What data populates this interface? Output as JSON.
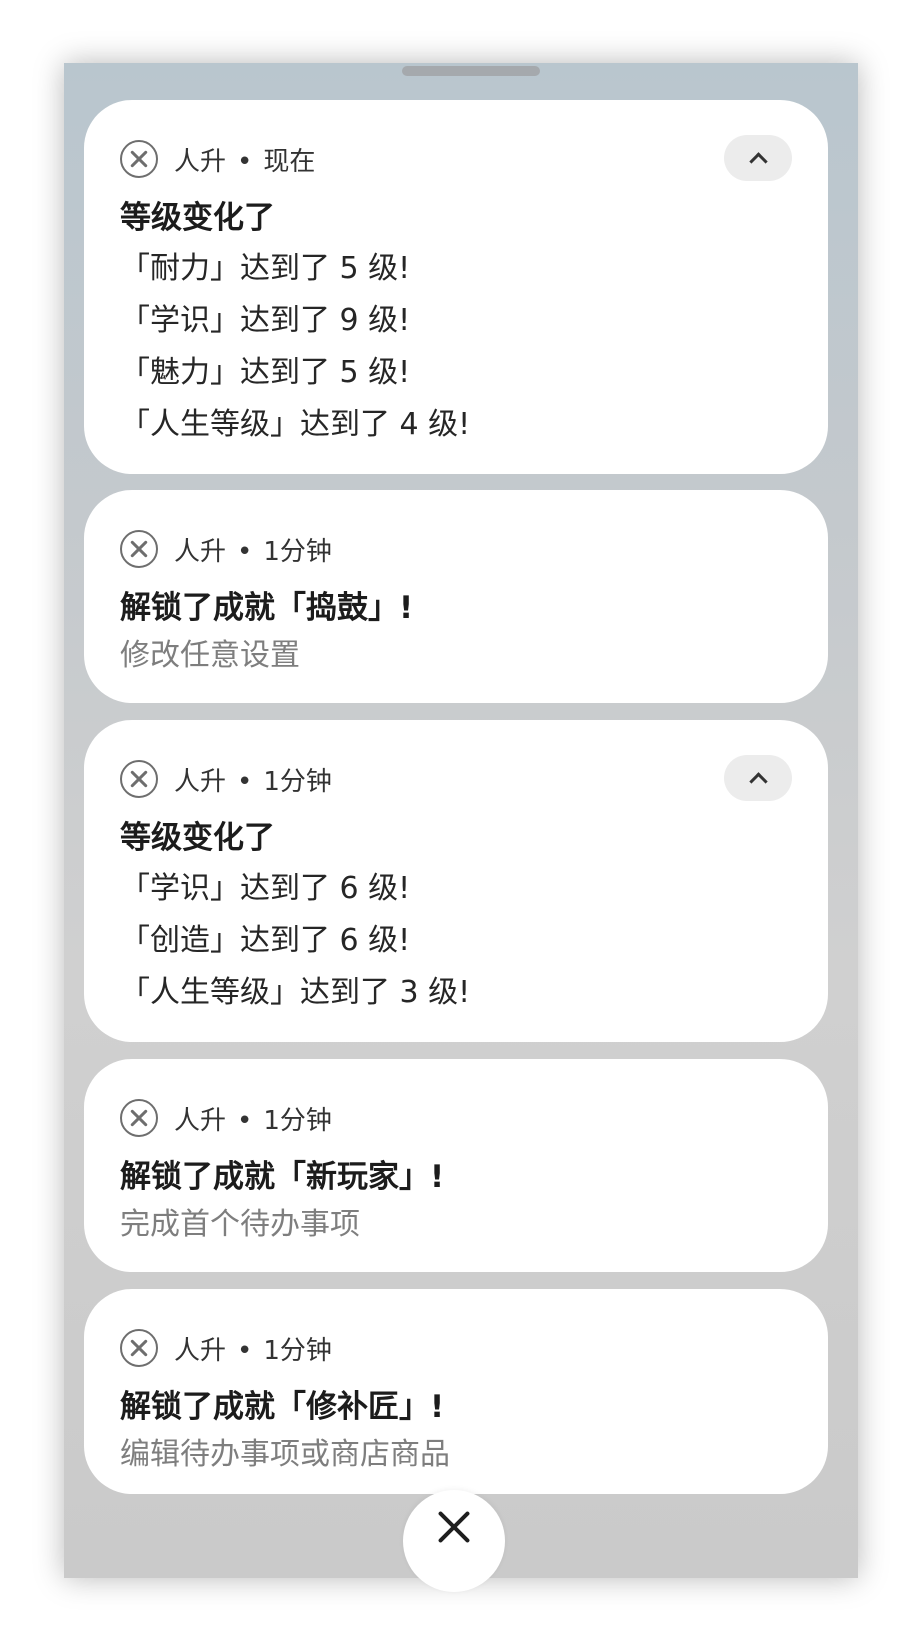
{
  "notifications": [
    {
      "app": "人升",
      "time": "现在",
      "title": "等级变化了",
      "lines": [
        "「耐力」达到了 5 级!",
        "「学识」达到了 9 级!",
        "「魅力」达到了 5 级!",
        "「人生等级」达到了 4 级!"
      ],
      "expanded": true
    },
    {
      "app": "人升",
      "time": "1分钟",
      "title": "解锁了成就「捣鼓」!",
      "subtitle": "修改任意设置"
    },
    {
      "app": "人升",
      "time": "1分钟",
      "title": "等级变化了",
      "lines": [
        "「学识」达到了 6 级!",
        "「创造」达到了 6 级!",
        "「人生等级」达到了 3 级!"
      ],
      "expanded": true
    },
    {
      "app": "人升",
      "time": "1分钟",
      "title": "解锁了成就「新玩家」!",
      "subtitle": "完成首个待办事项"
    },
    {
      "app": "人升",
      "time": "1分钟",
      "title": "解锁了成就「修补匠」!",
      "subtitle": "编辑待办事项或商店商品"
    }
  ],
  "separator": "•",
  "icons": {
    "app": "crossed-swords-icon",
    "collapse": "chevron-up-icon",
    "close": "close-icon"
  }
}
